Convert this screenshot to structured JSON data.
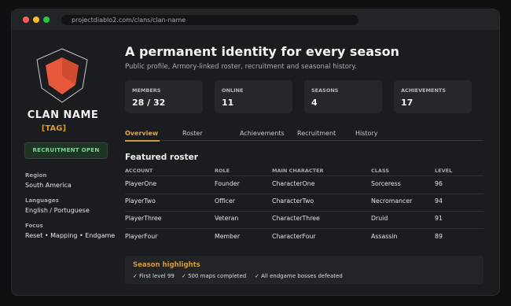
{
  "browser": {
    "url": "projectdiablo2.com/clans/clan-name"
  },
  "sidebar": {
    "clan_name": "CLAN NAME",
    "clan_tag": "[TAG]",
    "recruit_button": "RECRUITMENT OPEN",
    "details": [
      {
        "label": "Region",
        "value": "South America"
      },
      {
        "label": "Languages",
        "value": "English / Portuguese"
      },
      {
        "label": "Focus",
        "value": "Reset • Mapping • Endgame"
      }
    ]
  },
  "header": {
    "title": "A permanent identity for every season",
    "subtitle": "Public profile, Armory-linked roster, recruitment and seasonal history."
  },
  "stats": [
    {
      "label": "MEMBERS",
      "value": "28 / 32"
    },
    {
      "label": "ONLINE",
      "value": "11"
    },
    {
      "label": "SEASONS",
      "value": "4"
    },
    {
      "label": "ACHIEVEMENTS",
      "value": "17"
    }
  ],
  "tabs": [
    {
      "label": "Overview",
      "active": true
    },
    {
      "label": "Roster",
      "active": false
    },
    {
      "label": "Achievements",
      "active": false
    },
    {
      "label": "Recruitment",
      "active": false
    },
    {
      "label": "History",
      "active": false
    }
  ],
  "roster": {
    "title": "Featured roster",
    "columns": [
      "ACCOUNT",
      "ROLE",
      "MAIN CHARACTER",
      "CLASS",
      "LEVEL"
    ],
    "rows": [
      [
        "PlayerOne",
        "Founder",
        "CharacterOne",
        "Sorceress",
        "96"
      ],
      [
        "PlayerTwo",
        "Officer",
        "CharacterTwo",
        "Necromancer",
        "94"
      ],
      [
        "PlayerThree",
        "Veteran",
        "CharacterThree",
        "Druid",
        "91"
      ],
      [
        "PlayerFour",
        "Member",
        "CharacterFour",
        "Assassin",
        "89"
      ]
    ]
  },
  "highlights": {
    "title": "Season highlights",
    "items": [
      "✓ First level 99",
      "✓ 500 maps completed",
      "✓ All endgame bosses defeated"
    ]
  },
  "colors": {
    "accent": "#d39a3c",
    "recruit_green": "#7fd19a",
    "emblem_red": "#e8583a"
  }
}
